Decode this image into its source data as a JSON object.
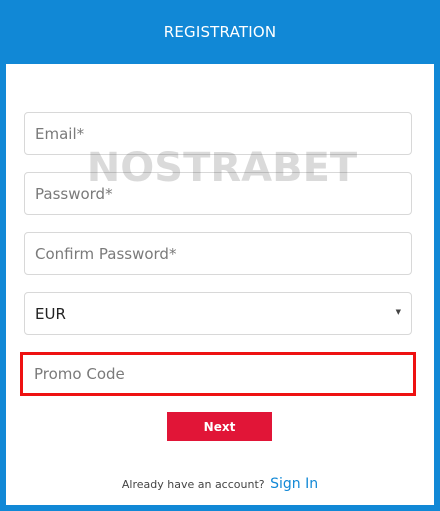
{
  "header": {
    "title": "REGISTRATION",
    "background_color": "#1188d6"
  },
  "form": {
    "email_placeholder": "Email*",
    "password_placeholder": "Password*",
    "confirm_password_placeholder": "Confirm Password*",
    "currency_selected": "EUR",
    "promo_placeholder": "Promo Code",
    "promo_highlight_color": "#ee1111",
    "next_label": "Next",
    "next_color": "#e11537"
  },
  "footer": {
    "prompt": "Already have an account?",
    "signin_label": "Sign In"
  },
  "watermark": {
    "text": "NOSTRABET"
  },
  "icons": {
    "select_arrow": "chevron-down-icon"
  }
}
